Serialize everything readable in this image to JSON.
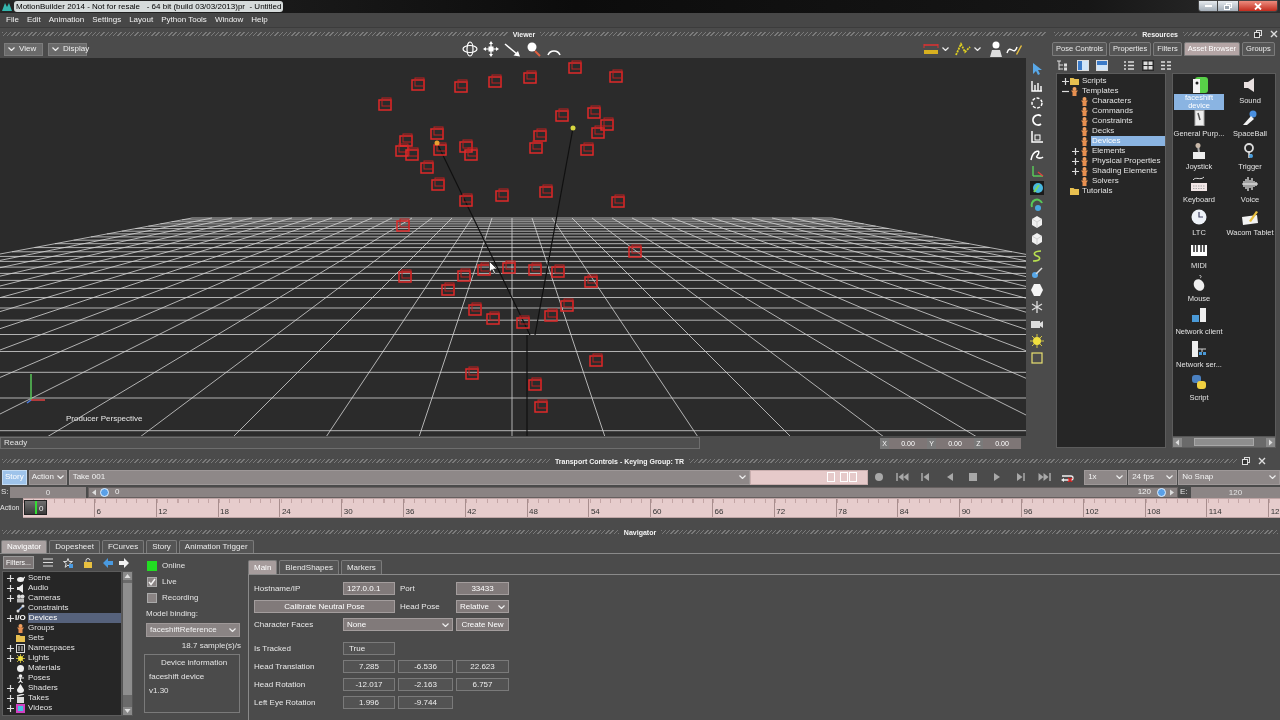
{
  "window": {
    "title": "MotionBuilder 2014 - Not for resale   - 64 bit (build 03/03/2013)pr  - Untitled"
  },
  "menu": [
    "File",
    "Edit",
    "Animation",
    "Settings",
    "Layout",
    "Python Tools",
    "Window",
    "Help"
  ],
  "viewer": {
    "title": "Viewer",
    "buttons": [
      "View",
      "Display"
    ],
    "camera_label": "Producer Perspective",
    "status": "Ready",
    "coordinates": [
      {
        "axis": "X",
        "value": "0.00"
      },
      {
        "axis": "Y",
        "value": "0.00"
      },
      {
        "axis": "Z",
        "value": "0.00"
      }
    ]
  },
  "resources": {
    "title": "Resources",
    "tabs": [
      {
        "label": "Pose Controls",
        "selected": false
      },
      {
        "label": "Properties",
        "selected": false
      },
      {
        "label": "Filters",
        "selected": false
      },
      {
        "label": "Asset Browser",
        "selected": true
      },
      {
        "label": "Groups",
        "selected": false
      }
    ],
    "tree": [
      {
        "label": "Scripts",
        "kind": "folder",
        "expanded": false,
        "selected": false
      },
      {
        "label": "Templates",
        "kind": "template",
        "expanded": true,
        "selected": false,
        "children": [
          {
            "label": "Characters",
            "kind": "template",
            "selected": false
          },
          {
            "label": "Commands",
            "kind": "template",
            "selected": false
          },
          {
            "label": "Constraints",
            "kind": "template",
            "selected": false
          },
          {
            "label": "Decks",
            "kind": "template",
            "selected": false
          },
          {
            "label": "Devices",
            "kind": "template",
            "selected": true
          },
          {
            "label": "Elements",
            "kind": "template",
            "expanded": false,
            "selected": false
          },
          {
            "label": "Physical Properties",
            "kind": "template",
            "expanded": false,
            "selected": false
          },
          {
            "label": "Shading Elements",
            "kind": "template",
            "expanded": false,
            "selected": false
          },
          {
            "label": "Solvers",
            "kind": "template",
            "selected": false
          }
        ]
      },
      {
        "label": "Tutorials",
        "kind": "folder",
        "selected": false
      }
    ],
    "assets": [
      {
        "label": "faceshift device",
        "selected": true
      },
      {
        "label": "General Purp...",
        "selected": false
      },
      {
        "label": "Joystick",
        "selected": false
      },
      {
        "label": "Keyboard",
        "selected": false
      },
      {
        "label": "LTC",
        "selected": false
      },
      {
        "label": "MIDI",
        "selected": false
      },
      {
        "label": "Mouse",
        "selected": false
      },
      {
        "label": "Network client",
        "selected": false
      },
      {
        "label": "Network ser...",
        "selected": false
      },
      {
        "label": "Script",
        "selected": false
      },
      {
        "label": "Sound",
        "selected": false
      },
      {
        "label": "SpaceBall",
        "selected": false
      },
      {
        "label": "Trigger",
        "selected": false
      },
      {
        "label": "Voice",
        "selected": false
      },
      {
        "label": "Wacom Tablet",
        "selected": false
      }
    ]
  },
  "transport": {
    "title": "Transport Controls - Keying Group: TR",
    "modes": [
      {
        "label": "Story",
        "kind": "toggle",
        "selected": true
      },
      {
        "label": "Action",
        "kind": "dropdown",
        "selected": false
      }
    ],
    "take": "Take 001",
    "speed": "1x",
    "fps": "24 fps",
    "snap": "No Snap",
    "start_label": "S:",
    "start": "0",
    "range_slider": {
      "start": "0",
      "end": "120",
      "level": 1
    },
    "end_label": "E:",
    "end": "120",
    "ruler_label": "Action",
    "current_frame": "0",
    "ruler_ticks": [
      "6",
      "12",
      "18",
      "24",
      "30",
      "36",
      "42",
      "48",
      "54",
      "60",
      "66",
      "72",
      "78",
      "84",
      "90",
      "96",
      "102",
      "108",
      "114",
      "12"
    ]
  },
  "navigator": {
    "title": "Navigator",
    "tabs": [
      {
        "label": "Navigator",
        "selected": true
      },
      {
        "label": "Dopesheet",
        "selected": false
      },
      {
        "label": "FCurves",
        "selected": false
      },
      {
        "label": "Story",
        "selected": false
      },
      {
        "label": "Animation Trigger",
        "selected": false
      }
    ],
    "filter_button": "Filters...",
    "tree": [
      {
        "label": "Scene",
        "expanded": false,
        "selected": false
      },
      {
        "label": "Audio",
        "expanded": false,
        "selected": false
      },
      {
        "label": "Cameras",
        "expanded": false,
        "selected": false
      },
      {
        "label": "Constraints",
        "selected": false
      },
      {
        "label": "Devices",
        "icon_text": "I/O",
        "expanded": false,
        "selected": true
      },
      {
        "label": "Groups",
        "selected": false
      },
      {
        "label": "Sets",
        "selected": false
      },
      {
        "label": "Namespaces",
        "expanded": false,
        "selected": false
      },
      {
        "label": "Lights",
        "expanded": false,
        "selected": false
      },
      {
        "label": "Materials",
        "selected": false
      },
      {
        "label": "Poses",
        "selected": false
      },
      {
        "label": "Shaders",
        "expanded": false,
        "selected": false
      },
      {
        "label": "Takes",
        "expanded": false,
        "selected": false
      },
      {
        "label": "Videos",
        "expanded": false,
        "selected": false
      }
    ],
    "device": {
      "online": {
        "label": "Online",
        "on": true
      },
      "options": [
        {
          "label": "Live",
          "checked": true
        },
        {
          "label": "Recording",
          "checked": false
        }
      ],
      "model_binding_label": "Model binding:",
      "model_binding": "faceshiftReference",
      "sample_rate": "18.7 sample(s)/s",
      "info_title": "Device information",
      "info_lines": [
        "faceshift device",
        "v1.30"
      ]
    },
    "settings": {
      "tabs": [
        {
          "label": "Main",
          "selected": true
        },
        {
          "label": "BlendShapes",
          "selected": false
        },
        {
          "label": "Markers",
          "selected": false
        }
      ],
      "hostname": {
        "label": "Hostname/IP",
        "value": "127.0.0.1"
      },
      "port": {
        "label": "Port",
        "value": "33433"
      },
      "calibrate_button": "Calibrate Neutral Pose",
      "head_pose": {
        "label": "Head Pose",
        "value": "Relative"
      },
      "character_faces": {
        "label": "Character Faces",
        "value": "None"
      },
      "create_button": "Create New",
      "is_tracked": {
        "label": "Is Tracked",
        "value": "True"
      },
      "vectors": [
        {
          "label": "Head Translation",
          "values": [
            "7.285",
            "-6.536",
            "22.623"
          ]
        },
        {
          "label": "Head Rotation",
          "values": [
            "-12.017",
            "-2.163",
            "6.757"
          ]
        },
        {
          "label": "Left Eye Rotation",
          "values": [
            "1.996",
            "-9.744"
          ]
        }
      ]
    }
  }
}
